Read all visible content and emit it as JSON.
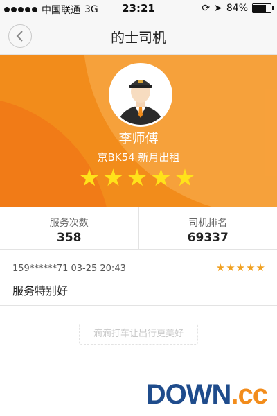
{
  "status_bar": {
    "carrier": "中国联通",
    "network": "3G",
    "time": "23:21",
    "battery": "84%",
    "battery_level": 0.84
  },
  "nav": {
    "title": "的士司机",
    "back_icon": "chevron-left-icon"
  },
  "driver": {
    "name": "李师傅",
    "plate_company": "京BK54  新月出租",
    "rating_stars": "★★★★★",
    "rating": 5
  },
  "stats": [
    {
      "label": "服务次数",
      "value": "358"
    },
    {
      "label": "司机排名",
      "value": "69337"
    }
  ],
  "review": {
    "user_time": "159******71 03-25 20:43",
    "stars": "★★★★★",
    "text": "服务特别好"
  },
  "footer": {
    "slogan": "滴滴打车让出行更美好"
  },
  "watermark": {
    "part1": "DOWN",
    "part2": ".cc"
  },
  "colors": {
    "accent": "#f28c1b",
    "star_yellow": "#ffe21a",
    "review_star": "#f0a020"
  }
}
